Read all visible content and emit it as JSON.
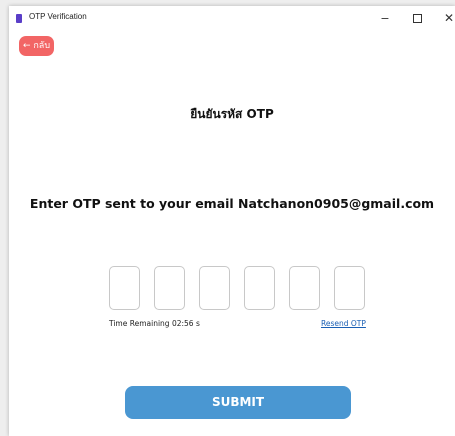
{
  "window": {
    "title": "OTP Verification",
    "minimize_glyph": "−",
    "close_glyph": "✕"
  },
  "back": {
    "label": "← กลับ"
  },
  "page": {
    "title": "ยืนยันรหัส OTP",
    "instruction": "Enter OTP sent to your email Natchanon0905@gmail.com"
  },
  "otp": {
    "digits": [
      "",
      "",
      "",
      "",
      "",
      ""
    ]
  },
  "timer": {
    "text": "Time Remaining 02:56 s"
  },
  "resend": {
    "label": "Resend OTP"
  },
  "submit": {
    "label": "SUBMIT"
  },
  "colors": {
    "back_button": "#f26565",
    "submit_button": "#4a97d2",
    "link": "#1a5fb4",
    "app_icon": "#5a3ec8"
  },
  "icons": {
    "app": "app-icon",
    "minimize": "minimize-icon",
    "maximize": "maximize-icon",
    "close": "close-icon"
  }
}
